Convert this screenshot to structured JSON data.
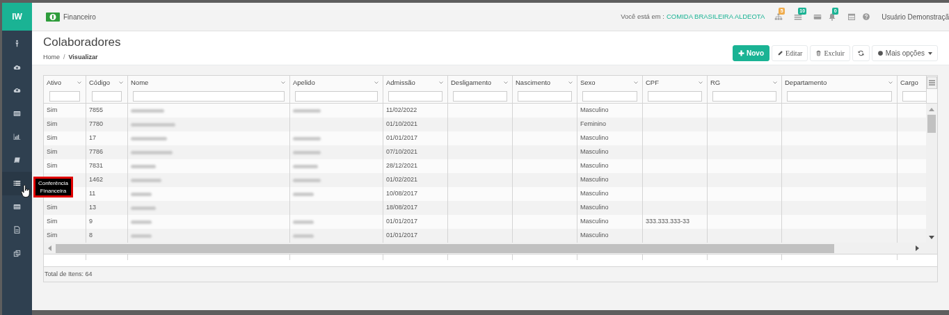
{
  "app": {
    "logo": "IW",
    "module": "Financeiro"
  },
  "sidebar": {
    "items": [
      {
        "selected": false
      },
      {
        "selected": false
      },
      {
        "selected": false
      },
      {
        "selected": false
      },
      {
        "selected": false
      },
      {
        "selected": false
      },
      {
        "selected": true
      },
      {
        "selected": false
      },
      {
        "selected": false
      },
      {
        "selected": false
      }
    ],
    "tooltip": "Conferência Financeira"
  },
  "topbar": {
    "location_label": "Você está em :",
    "location": "COMIDA BRASILEIRA ALDEOTA",
    "icons": [
      {
        "kind": "sitemap",
        "badge": "5",
        "color": "#f0ad4e"
      },
      {
        "kind": "tasks",
        "badge": "10",
        "color": "#1ab394"
      },
      {
        "kind": "card"
      },
      {
        "kind": "bell",
        "badge": "0",
        "color": "#1ab394"
      },
      {
        "kind": "calendar"
      },
      {
        "kind": "help"
      }
    ],
    "user": "Usuário Demonstraçã"
  },
  "page": {
    "title": "Colaboradores",
    "breadcrumb_separator": "/",
    "breadcrumb": [
      {
        "label": "Home",
        "selected": false
      },
      {
        "label": "Visualizar",
        "selected": true
      }
    ]
  },
  "toolbar": [
    {
      "kind": "new",
      "label": "Novo"
    },
    {
      "kind": "edit",
      "label": "Editar"
    },
    {
      "kind": "delete",
      "label": "Excluir"
    },
    {
      "kind": "refresh"
    },
    {
      "kind": "more",
      "label": "Mais opções"
    }
  ],
  "table": {
    "columns": [
      "Ativo",
      "Código",
      "Nome",
      "Apelido",
      "Admissão",
      "Desligamento",
      "Nascimento",
      "Sexo",
      "CPF",
      "RG",
      "Departamento",
      "Cargo"
    ],
    "rows": [
      [
        "Sim",
        "7855",
        {
          "kind": "redacted"
        },
        {
          "kind": "redacted"
        },
        "11/02/2022",
        null,
        null,
        "Masculino",
        null,
        null,
        null,
        null
      ],
      [
        "Sim",
        "7780",
        {
          "kind": "redacted"
        },
        null,
        "01/10/2021",
        null,
        null,
        "Feminino",
        null,
        null,
        null,
        null
      ],
      [
        "Sim",
        "17",
        {
          "kind": "redacted"
        },
        {
          "kind": "redacted"
        },
        "01/01/2017",
        null,
        null,
        "Masculino",
        null,
        null,
        null,
        null
      ],
      [
        "Sim",
        "7786",
        {
          "kind": "redacted"
        },
        {
          "kind": "redacted"
        },
        "07/10/2021",
        null,
        null,
        "Masculino",
        null,
        null,
        null,
        null
      ],
      [
        "Sim",
        "7831",
        {
          "kind": "redacted"
        },
        {
          "kind": "redacted"
        },
        "28/12/2021",
        null,
        null,
        "Masculino",
        null,
        null,
        null,
        null
      ],
      [
        null,
        "1462",
        {
          "kind": "redacted"
        },
        {
          "kind": "redacted"
        },
        "01/02/2021",
        null,
        null,
        "Masculino",
        null,
        null,
        null,
        null
      ],
      [
        null,
        "11",
        {
          "kind": "redacted"
        },
        {
          "kind": "redacted"
        },
        "10/08/2017",
        null,
        null,
        "Masculino",
        null,
        null,
        null,
        null
      ],
      [
        "Sim",
        "13",
        {
          "kind": "redacted"
        },
        null,
        "18/08/2017",
        null,
        null,
        "Masculino",
        null,
        null,
        null,
        null
      ],
      [
        "Sim",
        "9",
        {
          "kind": "redacted"
        },
        {
          "kind": "redacted"
        },
        "01/01/2017",
        null,
        null,
        "Masculino",
        "333.333.333-33",
        null,
        null,
        null
      ],
      [
        "Sim",
        "8",
        {
          "kind": "redacted"
        },
        {
          "kind": "redacted"
        },
        "01/01/2017",
        null,
        null,
        "Masculino",
        null,
        null,
        null,
        null
      ]
    ],
    "total": "Total de Itens: 64"
  }
}
